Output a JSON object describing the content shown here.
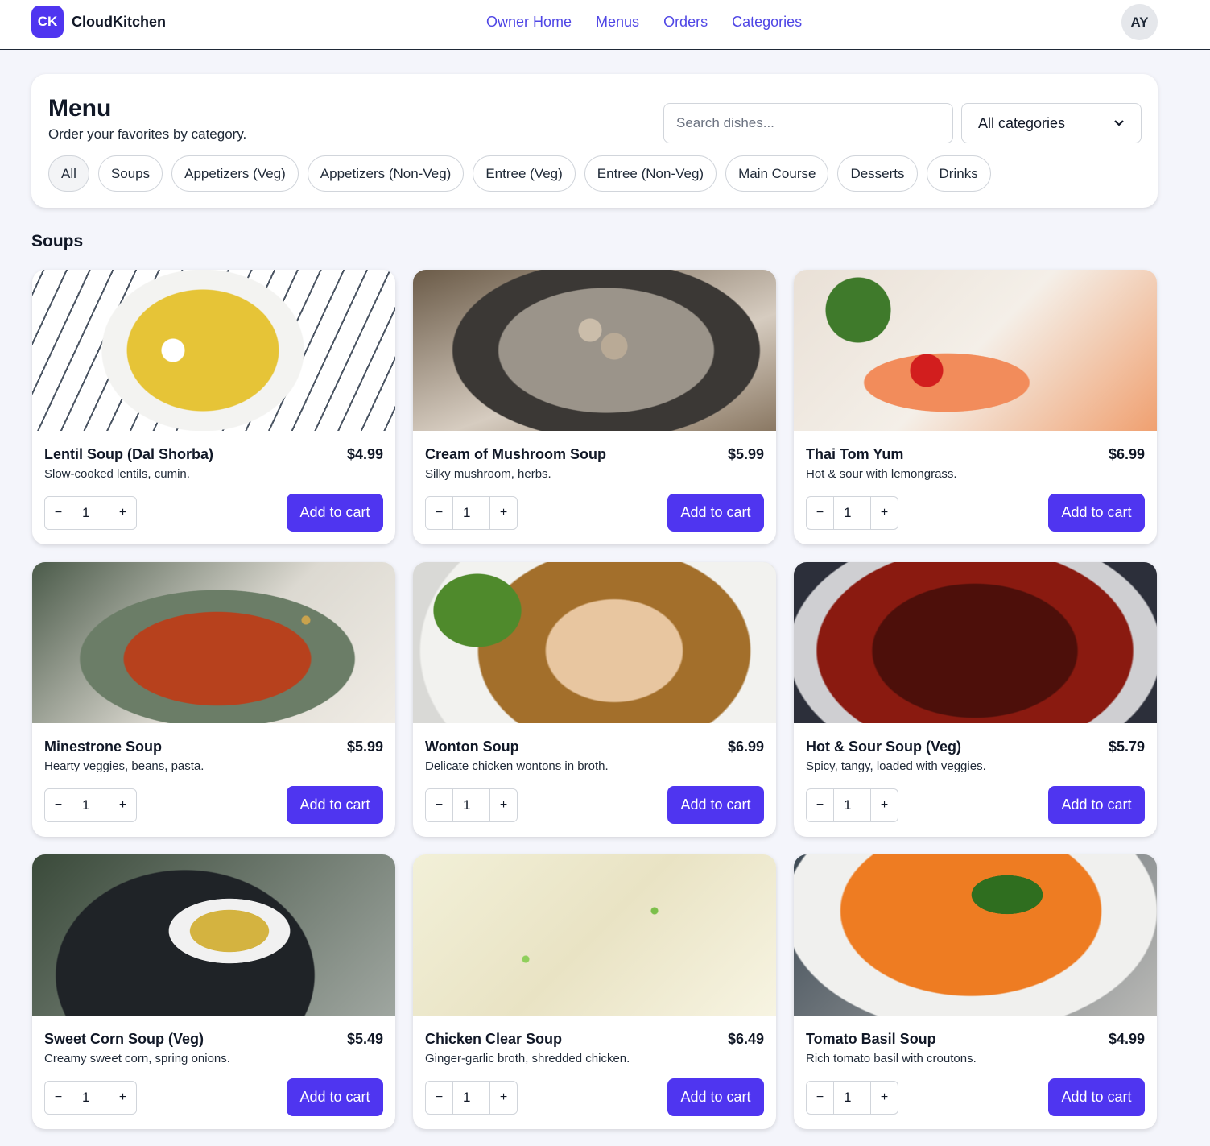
{
  "header": {
    "logo_badge": "CK",
    "brand": "CloudKitchen",
    "nav": [
      "Owner Home",
      "Menus",
      "Orders",
      "Categories"
    ],
    "avatar_initials": "AY"
  },
  "menu": {
    "title": "Menu",
    "subtitle": "Order your favorites by category.",
    "search_placeholder": "Search dishes...",
    "category_select": "All categories",
    "chips": [
      "All",
      "Soups",
      "Appetizers (Veg)",
      "Appetizers (Non-Veg)",
      "Entree (Veg)",
      "Entree (Non-Veg)",
      "Main Course",
      "Desserts",
      "Drinks"
    ],
    "active_chip": "All"
  },
  "section": {
    "title": "Soups",
    "add_label": "Add to cart",
    "minus": "−",
    "plus": "+",
    "items": [
      {
        "name": "Lentil Soup (Dal Shorba)",
        "price": "$4.99",
        "desc": "Slow-cooked lentils, cumin.",
        "qty": "1"
      },
      {
        "name": "Cream of Mushroom Soup",
        "price": "$5.99",
        "desc": "Silky mushroom, herbs.",
        "qty": "1"
      },
      {
        "name": "Thai Tom Yum",
        "price": "$6.99",
        "desc": "Hot & sour with lemongrass.",
        "qty": "1"
      },
      {
        "name": "Minestrone Soup",
        "price": "$5.99",
        "desc": "Hearty veggies, beans, pasta.",
        "qty": "1"
      },
      {
        "name": "Wonton Soup",
        "price": "$6.99",
        "desc": "Delicate chicken wontons in broth.",
        "qty": "1"
      },
      {
        "name": "Hot & Sour Soup (Veg)",
        "price": "$5.79",
        "desc": "Spicy, tangy, loaded with veggies.",
        "qty": "1"
      },
      {
        "name": "Sweet Corn Soup (Veg)",
        "price": "$5.49",
        "desc": "Creamy sweet corn, spring onions.",
        "qty": "1"
      },
      {
        "name": "Chicken Clear Soup",
        "price": "$6.49",
        "desc": "Ginger-garlic broth, shredded chicken.",
        "qty": "1"
      },
      {
        "name": "Tomato Basil Soup",
        "price": "$4.99",
        "desc": "Rich tomato basil with croutons.",
        "qty": "1"
      }
    ]
  },
  "colors": {
    "accent": "#4f35f0",
    "nav_link": "#4f46e5",
    "background": "#f4f5fb"
  }
}
